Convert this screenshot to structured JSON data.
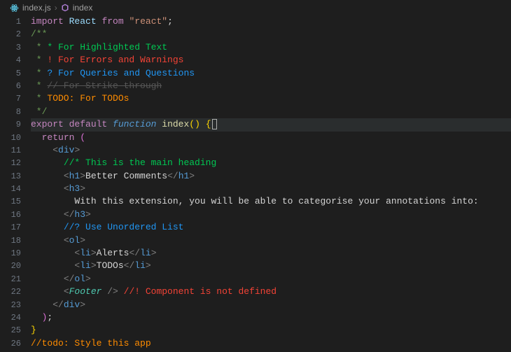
{
  "breadcrumb": {
    "file": "index.js",
    "symbol": "index"
  },
  "gutter": {
    "start": 1,
    "end": 26
  },
  "code": {
    "l1": {
      "import": "import",
      "react": "React",
      "from": "from",
      "str": "\"react\"",
      "semi": ";"
    },
    "l2": {
      "open": "/**"
    },
    "l3": {
      "star": " * ",
      "text": "* For Highlighted Text"
    },
    "l4": {
      "star": " * ",
      "text": "! For Errors and Warnings"
    },
    "l5": {
      "star": " * ",
      "text": "? For Queries and Questions"
    },
    "l6": {
      "star": " * ",
      "text": "// For Strike through"
    },
    "l7": {
      "star": " * ",
      "todo": "TODO:",
      "text": " For TODOs"
    },
    "l8": {
      "close": " */"
    },
    "l9": {
      "export": "export",
      "default": "default",
      "function": "function",
      "name": "index",
      "parens": "()",
      "brace": "{"
    },
    "l10": {
      "return": "return",
      "paren": "("
    },
    "l11": {
      "lt": "<",
      "tag": "div",
      "gt": ">"
    },
    "l12": {
      "text": "//* This is the main heading"
    },
    "l13": {
      "o_lt": "<",
      "o_tag": "h1",
      "o_gt": ">",
      "content": "Better Comments",
      "c_lt": "</",
      "c_tag": "h1",
      "c_gt": ">"
    },
    "l14": {
      "lt": "<",
      "tag": "h3",
      "gt": ">"
    },
    "l15": {
      "text": "With this extension, you will be able to categorise your annotations into:"
    },
    "l16": {
      "lt": "</",
      "tag": "h3",
      "gt": ">"
    },
    "l17": {
      "text": "//? Use Unordered List"
    },
    "l18": {
      "lt": "<",
      "tag": "ol",
      "gt": ">"
    },
    "l19": {
      "o_lt": "<",
      "o_tag": "li",
      "o_gt": ">",
      "content": "Alerts",
      "c_lt": "</",
      "c_tag": "li",
      "c_gt": ">"
    },
    "l20": {
      "o_lt": "<",
      "o_tag": "li",
      "o_gt": ">",
      "content": "TODOs",
      "c_lt": "</",
      "c_tag": "li",
      "c_gt": ">"
    },
    "l21": {
      "lt": "</",
      "tag": "ol",
      "gt": ">"
    },
    "l22": {
      "lt": "<",
      "tag": "Footer",
      "gt": " />",
      "comment": " //! Component is not defined"
    },
    "l23": {
      "lt": "</",
      "tag": "div",
      "gt": ">"
    },
    "l24": {
      "paren": ")",
      "semi": ";"
    },
    "l25": {
      "brace": "}"
    },
    "l26": {
      "text": "//todo: Style this app"
    }
  }
}
